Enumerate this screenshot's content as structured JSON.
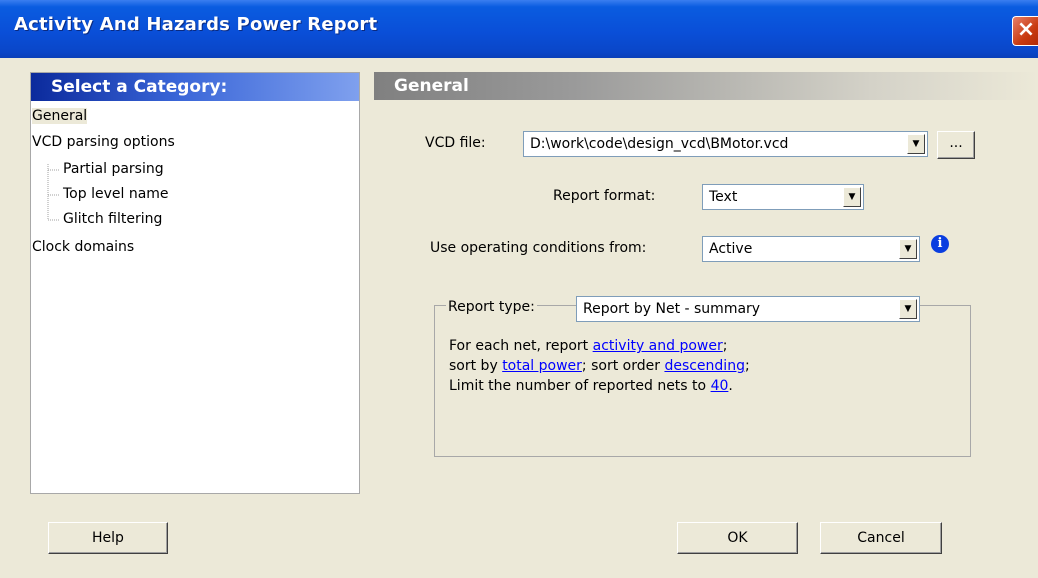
{
  "window": {
    "title": "Activity And Hazards Power Report",
    "close_label": "×"
  },
  "left_panel": {
    "header": "Select a Category:",
    "items": [
      {
        "label": "General"
      },
      {
        "label": "VCD parsing options"
      },
      {
        "label": "Partial parsing"
      },
      {
        "label": "Top level name"
      },
      {
        "label": "Glitch filtering"
      },
      {
        "label": "Clock domains"
      }
    ]
  },
  "right_panel": {
    "header": "General",
    "vcd_file": {
      "label": "VCD file:",
      "value": "D:\\work\\code\\design_vcd\\BMotor.vcd",
      "browse_label": "..."
    },
    "report_format": {
      "label": "Report format:",
      "value": "Text"
    },
    "operating_conditions": {
      "label": "Use operating conditions from:",
      "value": "Active",
      "info_icon": "i"
    },
    "report_type": {
      "label": "Report type:",
      "value": "Report by Net - summary",
      "line1_prefix": "For each net, report ",
      "line1_link": "activity and power",
      "line1_suffix": ";",
      "line2_prefix": "sort by ",
      "line2_link1": "total power",
      "line2_middle": "; sort order ",
      "line2_link2": "descending",
      "line2_suffix": ";",
      "line3_prefix": "Limit the number of reported nets to ",
      "line3_link": "40",
      "line3_suffix": "."
    }
  },
  "buttons": {
    "help": "Help",
    "ok": "OK",
    "cancel": "Cancel"
  },
  "colors": {
    "title_bar": "#0a4fd8",
    "category_header": "#2a52c8",
    "link": "#0000ff"
  }
}
